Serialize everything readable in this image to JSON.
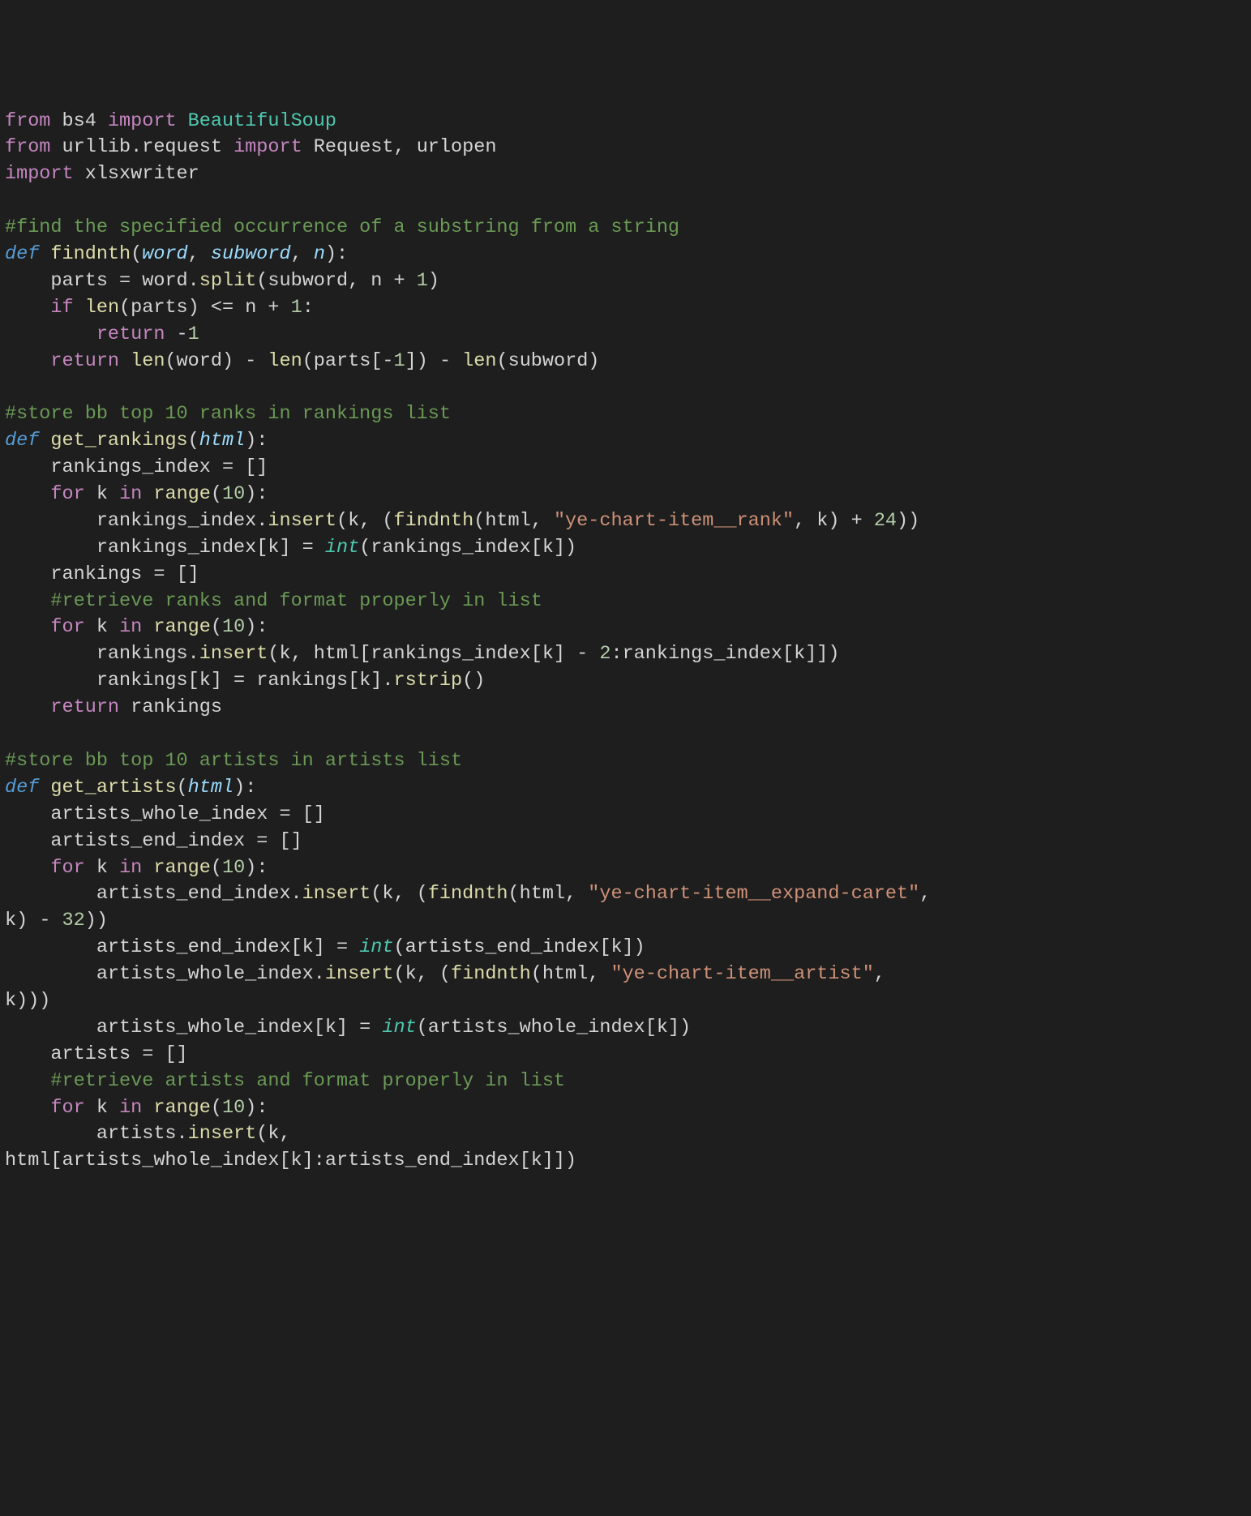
{
  "code": {
    "lines": [
      {
        "spans": [
          {
            "t": "from ",
            "c": "kw-from"
          },
          {
            "t": "bs4 ",
            "c": "plain"
          },
          {
            "t": "import ",
            "c": "kw-import"
          },
          {
            "t": "BeautifulSoup",
            "c": "module"
          }
        ]
      },
      {
        "spans": [
          {
            "t": "from ",
            "c": "kw-from"
          },
          {
            "t": "urllib.request ",
            "c": "plain"
          },
          {
            "t": "import ",
            "c": "kw-import"
          },
          {
            "t": "Request, urlopen",
            "c": "plain"
          }
        ]
      },
      {
        "spans": [
          {
            "t": "import ",
            "c": "kw-import"
          },
          {
            "t": "xlsxwriter",
            "c": "plain"
          }
        ]
      },
      {
        "spans": [
          {
            "t": "",
            "c": "plain"
          }
        ]
      },
      {
        "spans": [
          {
            "t": "#find the specified occurrence of a substring from a string",
            "c": "comment"
          }
        ]
      },
      {
        "spans": [
          {
            "t": "def ",
            "c": "kw-def"
          },
          {
            "t": "findnth",
            "c": "fn-name"
          },
          {
            "t": "(",
            "c": "plain"
          },
          {
            "t": "word",
            "c": "param"
          },
          {
            "t": ", ",
            "c": "plain"
          },
          {
            "t": "subword",
            "c": "param"
          },
          {
            "t": ", ",
            "c": "plain"
          },
          {
            "t": "n",
            "c": "param"
          },
          {
            "t": "):",
            "c": "plain"
          }
        ]
      },
      {
        "spans": [
          {
            "t": "    parts ",
            "c": "plain"
          },
          {
            "t": "= ",
            "c": "op"
          },
          {
            "t": "word.",
            "c": "plain"
          },
          {
            "t": "split",
            "c": "fn-call"
          },
          {
            "t": "(subword, n ",
            "c": "plain"
          },
          {
            "t": "+ ",
            "c": "op"
          },
          {
            "t": "1",
            "c": "num"
          },
          {
            "t": ")",
            "c": "plain"
          }
        ]
      },
      {
        "spans": [
          {
            "t": "    ",
            "c": "plain"
          },
          {
            "t": "if ",
            "c": "kw-ctrl"
          },
          {
            "t": "len",
            "c": "fn-call"
          },
          {
            "t": "(parts) ",
            "c": "plain"
          },
          {
            "t": "<= ",
            "c": "op"
          },
          {
            "t": "n ",
            "c": "plain"
          },
          {
            "t": "+ ",
            "c": "op"
          },
          {
            "t": "1",
            "c": "num"
          },
          {
            "t": ":",
            "c": "plain"
          }
        ]
      },
      {
        "spans": [
          {
            "t": "        ",
            "c": "plain"
          },
          {
            "t": "return ",
            "c": "kw-return"
          },
          {
            "t": "-",
            "c": "op"
          },
          {
            "t": "1",
            "c": "num"
          }
        ]
      },
      {
        "spans": [
          {
            "t": "    ",
            "c": "plain"
          },
          {
            "t": "return ",
            "c": "kw-return"
          },
          {
            "t": "len",
            "c": "fn-call"
          },
          {
            "t": "(word) ",
            "c": "plain"
          },
          {
            "t": "- ",
            "c": "op"
          },
          {
            "t": "len",
            "c": "fn-call"
          },
          {
            "t": "(parts[",
            "c": "plain"
          },
          {
            "t": "-",
            "c": "op"
          },
          {
            "t": "1",
            "c": "num"
          },
          {
            "t": "]) ",
            "c": "plain"
          },
          {
            "t": "- ",
            "c": "op"
          },
          {
            "t": "len",
            "c": "fn-call"
          },
          {
            "t": "(subword)",
            "c": "plain"
          }
        ]
      },
      {
        "spans": [
          {
            "t": "",
            "c": "plain"
          }
        ]
      },
      {
        "spans": [
          {
            "t": "#store bb top 10 ranks in rankings list",
            "c": "comment"
          }
        ]
      },
      {
        "spans": [
          {
            "t": "def ",
            "c": "kw-def"
          },
          {
            "t": "get_rankings",
            "c": "fn-name"
          },
          {
            "t": "(",
            "c": "plain"
          },
          {
            "t": "html",
            "c": "param"
          },
          {
            "t": "):",
            "c": "plain"
          }
        ]
      },
      {
        "spans": [
          {
            "t": "    rankings_index ",
            "c": "plain"
          },
          {
            "t": "= ",
            "c": "op"
          },
          {
            "t": "[]",
            "c": "plain"
          }
        ]
      },
      {
        "spans": [
          {
            "t": "    ",
            "c": "plain"
          },
          {
            "t": "for ",
            "c": "kw-ctrl"
          },
          {
            "t": "k ",
            "c": "plain"
          },
          {
            "t": "in ",
            "c": "kw-ctrl"
          },
          {
            "t": "range",
            "c": "fn-call"
          },
          {
            "t": "(",
            "c": "plain"
          },
          {
            "t": "10",
            "c": "num"
          },
          {
            "t": "):",
            "c": "plain"
          }
        ]
      },
      {
        "spans": [
          {
            "t": "        rankings_index.",
            "c": "plain"
          },
          {
            "t": "insert",
            "c": "fn-call"
          },
          {
            "t": "(k, (",
            "c": "plain"
          },
          {
            "t": "findnth",
            "c": "fn-call"
          },
          {
            "t": "(html, ",
            "c": "plain"
          },
          {
            "t": "\"ye-chart-item__rank\"",
            "c": "str"
          },
          {
            "t": ", k) ",
            "c": "plain"
          },
          {
            "t": "+ ",
            "c": "op"
          },
          {
            "t": "24",
            "c": "num"
          },
          {
            "t": "))",
            "c": "plain"
          }
        ]
      },
      {
        "spans": [
          {
            "t": "        rankings_index[k] ",
            "c": "plain"
          },
          {
            "t": "= ",
            "c": "op"
          },
          {
            "t": "int",
            "c": "builtin"
          },
          {
            "t": "(rankings_index[k])",
            "c": "plain"
          }
        ]
      },
      {
        "spans": [
          {
            "t": "    rankings ",
            "c": "plain"
          },
          {
            "t": "= ",
            "c": "op"
          },
          {
            "t": "[]",
            "c": "plain"
          }
        ]
      },
      {
        "spans": [
          {
            "t": "    ",
            "c": "plain"
          },
          {
            "t": "#retrieve ranks and format properly in list",
            "c": "comment"
          }
        ]
      },
      {
        "spans": [
          {
            "t": "    ",
            "c": "plain"
          },
          {
            "t": "for ",
            "c": "kw-ctrl"
          },
          {
            "t": "k ",
            "c": "plain"
          },
          {
            "t": "in ",
            "c": "kw-ctrl"
          },
          {
            "t": "range",
            "c": "fn-call"
          },
          {
            "t": "(",
            "c": "plain"
          },
          {
            "t": "10",
            "c": "num"
          },
          {
            "t": "):",
            "c": "plain"
          }
        ]
      },
      {
        "spans": [
          {
            "t": "        rankings.",
            "c": "plain"
          },
          {
            "t": "insert",
            "c": "fn-call"
          },
          {
            "t": "(k, html[rankings_index[k] ",
            "c": "plain"
          },
          {
            "t": "- ",
            "c": "op"
          },
          {
            "t": "2",
            "c": "num"
          },
          {
            "t": ":rankings_index[k]])",
            "c": "plain"
          }
        ]
      },
      {
        "spans": [
          {
            "t": "        rankings[k] ",
            "c": "plain"
          },
          {
            "t": "= ",
            "c": "op"
          },
          {
            "t": "rankings[k].",
            "c": "plain"
          },
          {
            "t": "rstrip",
            "c": "fn-call"
          },
          {
            "t": "()",
            "c": "plain"
          }
        ]
      },
      {
        "spans": [
          {
            "t": "    ",
            "c": "plain"
          },
          {
            "t": "return ",
            "c": "kw-return"
          },
          {
            "t": "rankings",
            "c": "plain"
          }
        ]
      },
      {
        "spans": [
          {
            "t": "",
            "c": "plain"
          }
        ]
      },
      {
        "spans": [
          {
            "t": "#store bb top 10 artists in artists list",
            "c": "comment"
          }
        ]
      },
      {
        "spans": [
          {
            "t": "def ",
            "c": "kw-def"
          },
          {
            "t": "get_artists",
            "c": "fn-name"
          },
          {
            "t": "(",
            "c": "plain"
          },
          {
            "t": "html",
            "c": "param"
          },
          {
            "t": "):",
            "c": "plain"
          }
        ]
      },
      {
        "spans": [
          {
            "t": "    artists_whole_index ",
            "c": "plain"
          },
          {
            "t": "= ",
            "c": "op"
          },
          {
            "t": "[]",
            "c": "plain"
          }
        ]
      },
      {
        "spans": [
          {
            "t": "    artists_end_index ",
            "c": "plain"
          },
          {
            "t": "= ",
            "c": "op"
          },
          {
            "t": "[]",
            "c": "plain"
          }
        ]
      },
      {
        "spans": [
          {
            "t": "    ",
            "c": "plain"
          },
          {
            "t": "for ",
            "c": "kw-ctrl"
          },
          {
            "t": "k ",
            "c": "plain"
          },
          {
            "t": "in ",
            "c": "kw-ctrl"
          },
          {
            "t": "range",
            "c": "fn-call"
          },
          {
            "t": "(",
            "c": "plain"
          },
          {
            "t": "10",
            "c": "num"
          },
          {
            "t": "):",
            "c": "plain"
          }
        ]
      },
      {
        "spans": [
          {
            "t": "        artists_end_index.",
            "c": "plain"
          },
          {
            "t": "insert",
            "c": "fn-call"
          },
          {
            "t": "(k, (",
            "c": "plain"
          },
          {
            "t": "findnth",
            "c": "fn-call"
          },
          {
            "t": "(html, ",
            "c": "plain"
          },
          {
            "t": "\"ye-chart-item__expand-caret\"",
            "c": "str"
          },
          {
            "t": ", ",
            "c": "plain"
          }
        ]
      },
      {
        "spans": [
          {
            "t": "k) ",
            "c": "plain"
          },
          {
            "t": "- ",
            "c": "op"
          },
          {
            "t": "32",
            "c": "num"
          },
          {
            "t": "))",
            "c": "plain"
          }
        ]
      },
      {
        "spans": [
          {
            "t": "        artists_end_index[k] ",
            "c": "plain"
          },
          {
            "t": "= ",
            "c": "op"
          },
          {
            "t": "int",
            "c": "builtin"
          },
          {
            "t": "(artists_end_index[k])",
            "c": "plain"
          }
        ]
      },
      {
        "spans": [
          {
            "t": "        artists_whole_index.",
            "c": "plain"
          },
          {
            "t": "insert",
            "c": "fn-call"
          },
          {
            "t": "(k, (",
            "c": "plain"
          },
          {
            "t": "findnth",
            "c": "fn-call"
          },
          {
            "t": "(html, ",
            "c": "plain"
          },
          {
            "t": "\"ye-chart-item__artist\"",
            "c": "str"
          },
          {
            "t": ", ",
            "c": "plain"
          }
        ]
      },
      {
        "spans": [
          {
            "t": "k)))",
            "c": "plain"
          }
        ]
      },
      {
        "spans": [
          {
            "t": "        artists_whole_index[k] ",
            "c": "plain"
          },
          {
            "t": "= ",
            "c": "op"
          },
          {
            "t": "int",
            "c": "builtin"
          },
          {
            "t": "(artists_whole_index[k])",
            "c": "plain"
          }
        ]
      },
      {
        "spans": [
          {
            "t": "    artists ",
            "c": "plain"
          },
          {
            "t": "= ",
            "c": "op"
          },
          {
            "t": "[]",
            "c": "plain"
          }
        ]
      },
      {
        "spans": [
          {
            "t": "    ",
            "c": "plain"
          },
          {
            "t": "#retrieve artists and format properly in list",
            "c": "comment"
          }
        ]
      },
      {
        "spans": [
          {
            "t": "    ",
            "c": "plain"
          },
          {
            "t": "for ",
            "c": "kw-ctrl"
          },
          {
            "t": "k ",
            "c": "plain"
          },
          {
            "t": "in ",
            "c": "kw-ctrl"
          },
          {
            "t": "range",
            "c": "fn-call"
          },
          {
            "t": "(",
            "c": "plain"
          },
          {
            "t": "10",
            "c": "num"
          },
          {
            "t": "):",
            "c": "plain"
          }
        ]
      },
      {
        "spans": [
          {
            "t": "        artists.",
            "c": "plain"
          },
          {
            "t": "insert",
            "c": "fn-call"
          },
          {
            "t": "(k, ",
            "c": "plain"
          }
        ]
      },
      {
        "spans": [
          {
            "t": "html[artists_whole_index[k]:artists_end_index[k]])",
            "c": "plain"
          }
        ]
      }
    ]
  }
}
